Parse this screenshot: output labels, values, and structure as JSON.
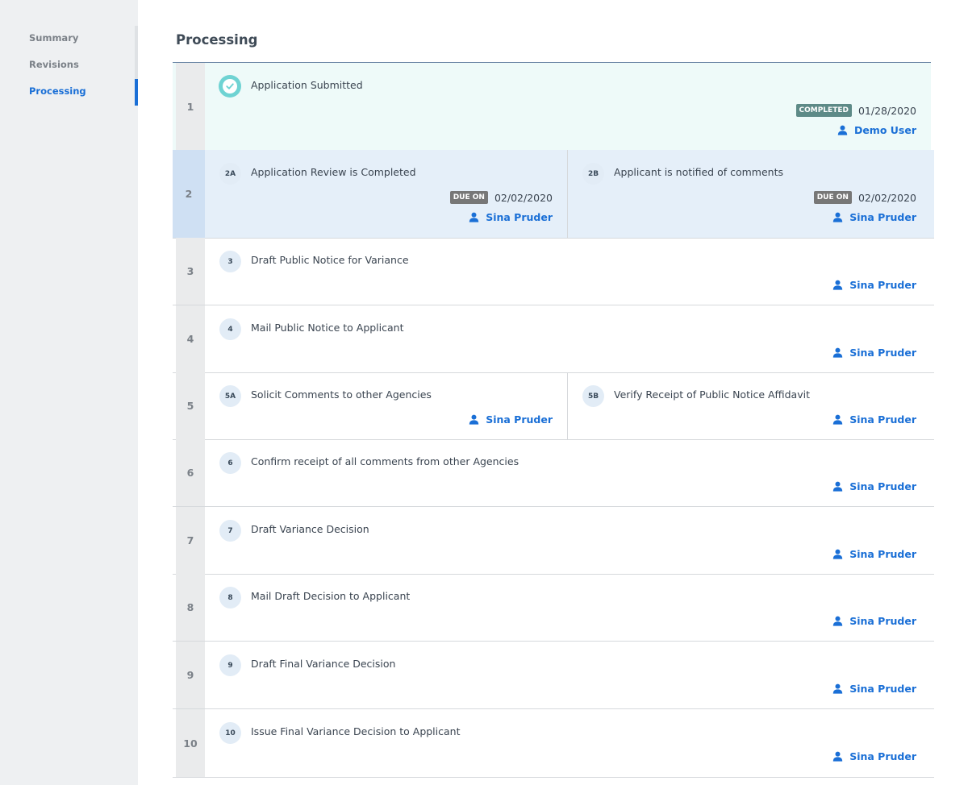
{
  "sidebar": {
    "items": [
      {
        "label": "Summary"
      },
      {
        "label": "Revisions"
      },
      {
        "label": "Processing"
      }
    ]
  },
  "page_title": "Processing",
  "colors": {
    "accent": "#1a6fd6",
    "completed_row_bg": "#eefaf9",
    "active_row_bg": "#e5eff9",
    "completed_tag": "#5d8a87",
    "due_tag": "#777777"
  },
  "steps": [
    {
      "num": "1",
      "tasks": [
        {
          "icon": "check-circle-icon",
          "label": "Application Submitted",
          "tag": "COMPLETED",
          "date": "01/28/2020",
          "user": "Demo User"
        }
      ]
    },
    {
      "num": "2",
      "tasks": [
        {
          "badge": "2A",
          "label": "Application Review is Completed",
          "tag": "DUE ON",
          "date": "02/02/2020",
          "user": "Sina Pruder"
        },
        {
          "badge": "2B",
          "label": "Applicant is notified of comments",
          "tag": "DUE ON",
          "date": "02/02/2020",
          "user": "Sina Pruder"
        }
      ]
    },
    {
      "num": "3",
      "tasks": [
        {
          "badge": "3",
          "label": "Draft Public Notice for Variance",
          "user": "Sina Pruder"
        }
      ]
    },
    {
      "num": "4",
      "tasks": [
        {
          "badge": "4",
          "label": "Mail Public Notice to Applicant",
          "user": "Sina Pruder"
        }
      ]
    },
    {
      "num": "5",
      "tasks": [
        {
          "badge": "5A",
          "label": "Solicit Comments to other Agencies",
          "user": "Sina Pruder"
        },
        {
          "badge": "5B",
          "label": "Verify Receipt of Public Notice Affidavit",
          "user": "Sina Pruder"
        }
      ]
    },
    {
      "num": "6",
      "tasks": [
        {
          "badge": "6",
          "label": "Confirm receipt of all comments from other Agencies",
          "user": "Sina Pruder"
        }
      ]
    },
    {
      "num": "7",
      "tasks": [
        {
          "badge": "7",
          "label": "Draft Variance Decision",
          "user": "Sina Pruder"
        }
      ]
    },
    {
      "num": "8",
      "tasks": [
        {
          "badge": "8",
          "label": "Mail Draft Decision to Applicant",
          "user": "Sina Pruder"
        }
      ]
    },
    {
      "num": "9",
      "tasks": [
        {
          "badge": "9",
          "label": "Draft Final Variance Decision",
          "user": "Sina Pruder"
        }
      ]
    },
    {
      "num": "10",
      "tasks": [
        {
          "badge": "10",
          "label": "Issue Final Variance Decision to Applicant",
          "user": "Sina Pruder"
        }
      ]
    }
  ]
}
